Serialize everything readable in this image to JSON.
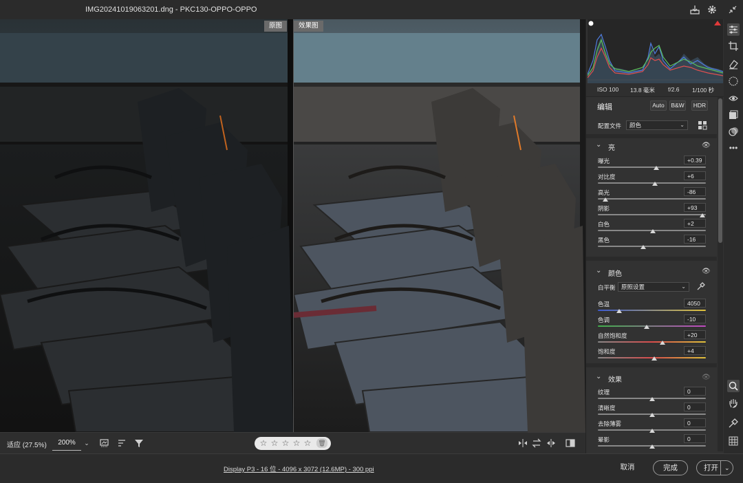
{
  "window": {
    "title": "IMG20241019063201.dng  -  PKC130-OPPO-OPPO",
    "save_icon": "save-icon",
    "settings_icon": "gear-icon",
    "collapse_icon": "collapse-icon"
  },
  "view": {
    "before_label": "原图",
    "after_label": "效果图"
  },
  "photo_toolbar": {
    "fit_label": "适应 (27.5%)",
    "zoom_value": "200%",
    "rating_stars": 5,
    "rating_value": 0
  },
  "footer": {
    "info": "Display P3 - 16 位 - 4096 x 3072 (12.6MP) - 300 ppi",
    "cancel": "取消",
    "done": "完成",
    "open": "打开"
  },
  "exif": {
    "iso": "ISO 100",
    "focal": "13.8 毫米",
    "aperture": "f/2.6",
    "shutter": "1/100 秒"
  },
  "edit": {
    "title": "编辑",
    "auto": "Auto",
    "bw": "B&W",
    "hdr": "HDR",
    "profile_label": "配置文件",
    "profile_value": "颜色"
  },
  "light": {
    "title": "亮",
    "sliders": [
      {
        "label": "曝光",
        "value": "+0.39",
        "pos": 0.539
      },
      {
        "label": "对比度",
        "value": "+6",
        "pos": 0.53
      },
      {
        "label": "高光",
        "value": "-86",
        "pos": 0.07
      },
      {
        "label": "阴影",
        "value": "+93",
        "pos": 0.965
      },
      {
        "label": "白色",
        "value": "+2",
        "pos": 0.51
      },
      {
        "label": "黑色",
        "value": "-16",
        "pos": 0.42
      }
    ]
  },
  "color": {
    "title": "颜色",
    "wb_label": "白平衡",
    "wb_value": "原照设置",
    "sliders": [
      {
        "label": "色温",
        "value": "4050",
        "pos": 0.2
      },
      {
        "label": "色调",
        "value": "-10",
        "pos": 0.45
      },
      {
        "label": "自然饱和度",
        "value": "+20",
        "pos": 0.6
      },
      {
        "label": "饱和度",
        "value": "+4",
        "pos": 0.52
      }
    ]
  },
  "effects": {
    "title": "效果",
    "sliders": [
      {
        "label": "纹理",
        "value": "0",
        "pos": 0.5
      },
      {
        "label": "清晰度",
        "value": "0",
        "pos": 0.5
      },
      {
        "label": "去除薄雾",
        "value": "0",
        "pos": 0.5
      },
      {
        "label": "晕影",
        "value": "0",
        "pos": 0.5
      }
    ]
  },
  "colors": {
    "bg": "#2b2b2b",
    "panel": "#323232",
    "accent_white": "#e6e6e6"
  }
}
